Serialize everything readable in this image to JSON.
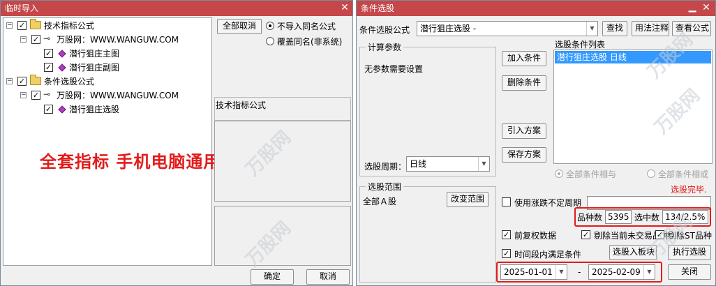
{
  "left_window": {
    "title": "临时导入",
    "close_symbol": "✕",
    "tree": {
      "tech_group": "技术指标公式",
      "tech_source": "万股网：WWW.WANGUW.COM",
      "tech_item_1": "潜行狙庄主图",
      "tech_item_2": "潜行狙庄副图",
      "cond_group": "条件选股公式",
      "cond_source": "万股网：WWW.WANGUW.COM",
      "cond_item_1": "潜行狙庄选股"
    },
    "promo_text": "全套指标  手机电脑通用",
    "deselect_all": "全部取消",
    "radio_no_import": "不导入同名公式",
    "radio_overwrite": "覆盖同名(非系统)",
    "formula_label": "技术指标公式",
    "ok": "确定",
    "cancel": "取消"
  },
  "right_window": {
    "title": "条件选股",
    "minimize_symbol": "▁",
    "close_symbol": "✕",
    "formula_label": "条件选股公式",
    "formula_value": "潜行狙庄选股  -",
    "find": "查找",
    "usage_note": "用法注释",
    "view_formula": "查看公式",
    "calc_params_title": "计算参数",
    "no_params": "无参数需要设置",
    "period_label": "选股周期：",
    "period_value": "日线",
    "add_condition": "加入条件",
    "remove_condition": "删除条件",
    "import_plan": "引入方案",
    "save_plan": "保存方案",
    "condition_list_title": "选股条件列表",
    "condition_item": "潜行狙庄选股  日线",
    "all_and": "全部条件相与",
    "all_or": "全部条件相或",
    "range_title": "选股范围",
    "range_value": "全部Ａ股",
    "change_range": "改变范围",
    "status": "选股完毕.",
    "use_period": "使用涨跌不定周期",
    "count_label": "品种数",
    "count_value": "5395",
    "selected_label": "选中数",
    "selected_value": "134/2.5%",
    "pre_adjust": "前复权数据",
    "exclude_untraded": "剔除当前未交易品种",
    "exclude_st": "剔除ST品种",
    "time_range": "时间段内满足条件",
    "select_into_block": "选股入板块",
    "run_select": "执行选股",
    "date_from": "2025-01-01",
    "date_sep": "-",
    "date_to": "2025-02-09",
    "close": "关闭"
  },
  "watermark": "万股网",
  "colors": {
    "titlebar": "#c5474a",
    "promo": "#e21b1b",
    "selection": "#3399ff",
    "status": "#e21b1b",
    "highlight": "#e21b1b"
  },
  "icons": {
    "checked": "✓",
    "expander": "−",
    "key": "⊸",
    "dropdown": "▼"
  }
}
